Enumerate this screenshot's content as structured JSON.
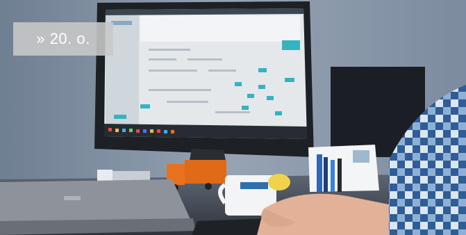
{
  "overlay": {
    "label": "» 20. o."
  },
  "photo": {
    "colors": {
      "wall": "#8795a6",
      "monitor": "#202328",
      "screen": "#e3e7ea",
      "teal": "#35b3bf",
      "truck": "#e8721d",
      "shirt": "#3f6ea5",
      "laptop": "#8c9199",
      "skin": "#e4b49a"
    }
  }
}
